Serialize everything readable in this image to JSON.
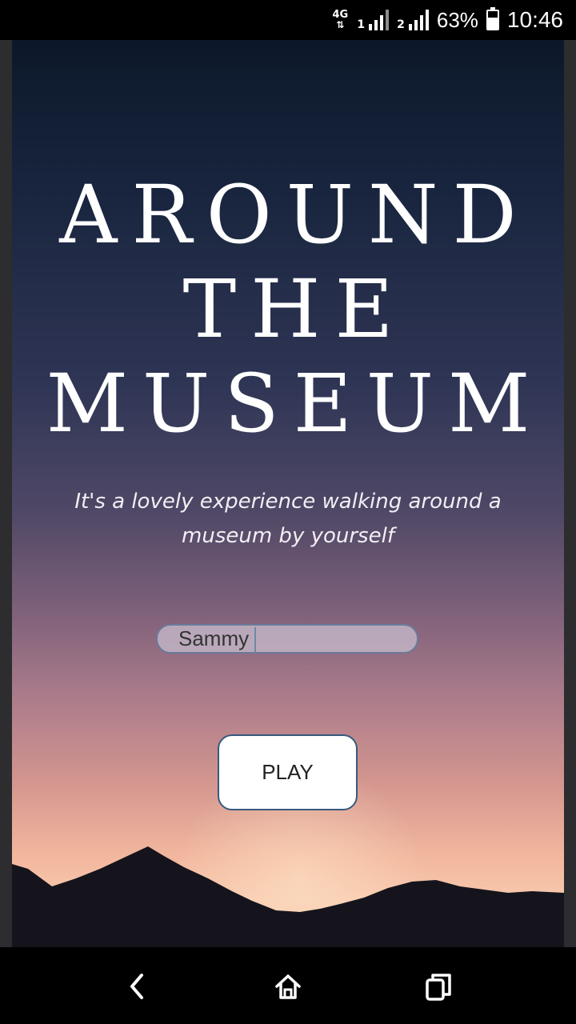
{
  "status_bar": {
    "network": "4G",
    "sim1": "1",
    "sim2": "2",
    "battery_percent": "63%",
    "battery_level": 0.63,
    "time": "10:46"
  },
  "app": {
    "title_lines": [
      "AROUND",
      "THE",
      "MUSEUM"
    ],
    "subtitle": "It's a lovely experience walking around a museum by yourself",
    "name_input": {
      "value": "Sammy",
      "placeholder": ""
    },
    "play_label": "PLAY"
  },
  "navigation": {
    "back_icon": "back-icon",
    "home_icon": "home-icon",
    "recents_icon": "recents-icon"
  }
}
